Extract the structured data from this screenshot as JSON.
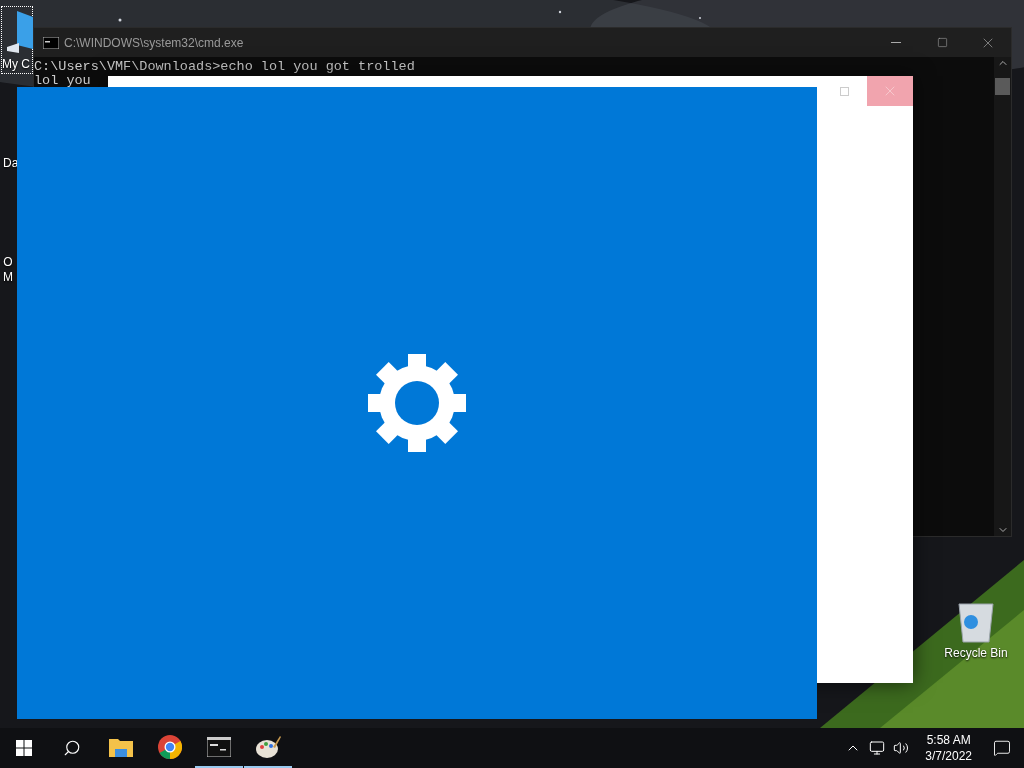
{
  "desktop": {
    "icons": [
      {
        "kind": "computer",
        "lines": [
          "My C"
        ],
        "selected": true
      },
      {
        "kind": "partial",
        "lines": [
          "Da"
        ],
        "selected": false
      },
      {
        "kind": "partial",
        "lines": [
          "O",
          "M"
        ],
        "selected": false
      },
      {
        "kind": "recycle",
        "lines": [
          "Recycle Bin"
        ],
        "selected": false
      }
    ]
  },
  "cmd_window": {
    "title": "C:\\WINDOWS\\system32\\cmd.exe",
    "lines": [
      "C:\\Users\\VMF\\Downloads>echo lol you got trolled",
      "lol you"
    ]
  },
  "blank_window": {
    "close_hovered": true
  },
  "taskbar": {
    "apps": [
      {
        "kind": "explorer",
        "active": false
      },
      {
        "kind": "chrome",
        "active": false
      },
      {
        "kind": "cmd",
        "active": true
      },
      {
        "kind": "paint",
        "active": true
      }
    ],
    "time": "5:58 AM",
    "date": "3/7/2022"
  }
}
